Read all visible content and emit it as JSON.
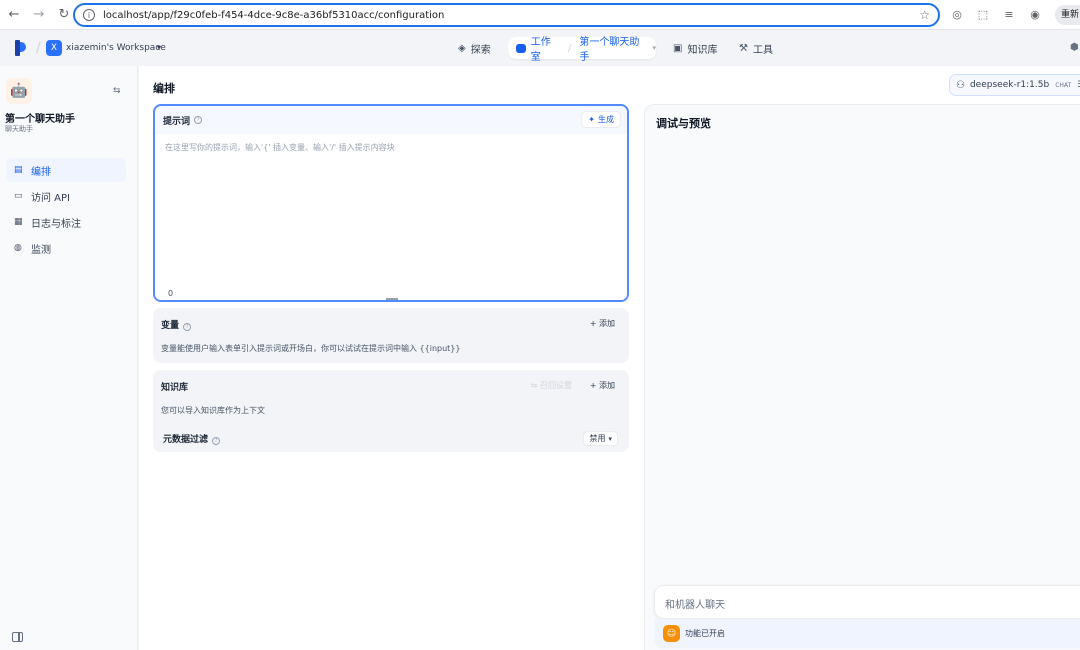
{
  "browser": {
    "url": "localhost/app/f29c0feb-f454-4dce-9c8e-a36bf5310acc/configuration",
    "relaunch_label": "重新"
  },
  "header": {
    "workspace_initial": "X",
    "workspace_name": "xiazemin's Workspace",
    "nav": {
      "explore": "探索",
      "studio": "工作室",
      "current_app": "第一个聊天助手",
      "knowledge": "知识库",
      "tools": "工具"
    }
  },
  "sidebar": {
    "app_name": "第一个聊天助手",
    "app_type": "聊天助手",
    "items": [
      {
        "label": "编排",
        "icon": "layout-icon"
      },
      {
        "label": "访问 API",
        "icon": "terminal-icon"
      },
      {
        "label": "日志与标注",
        "icon": "document-icon"
      },
      {
        "label": "监测",
        "icon": "gauge-icon"
      }
    ]
  },
  "compose": {
    "title": "编排",
    "model": {
      "name": "deepseek-r1:1.5b",
      "mode": "CHAT"
    },
    "prompt": {
      "label": "提示词",
      "generate_label": "生成",
      "placeholder": "在这里写你的提示词，输入'{' 插入变量、输入'/' 插入提示内容块",
      "char_count": "0"
    },
    "variables": {
      "label": "变量",
      "add_label": "添加",
      "description": "变量能使用户输入表单引入提示词或开场白，你可以试试在提示词中输入 {{input}}"
    },
    "knowledge": {
      "label": "知识库",
      "settings_label": "召回设置",
      "add_label": "添加",
      "description": "您可以导入知识库作为上下文",
      "metadata_filter_label": "元数据过滤",
      "metadata_filter_value": "禁用"
    }
  },
  "debug": {
    "title": "调试与预览",
    "chat_placeholder": "和机器人聊天",
    "feature_status": "功能已开启"
  },
  "colors": {
    "accent": "#155eef",
    "focus_border": "#528bff",
    "workspace_avatar": "#2970ff",
    "feature_icon": "#f79009"
  }
}
